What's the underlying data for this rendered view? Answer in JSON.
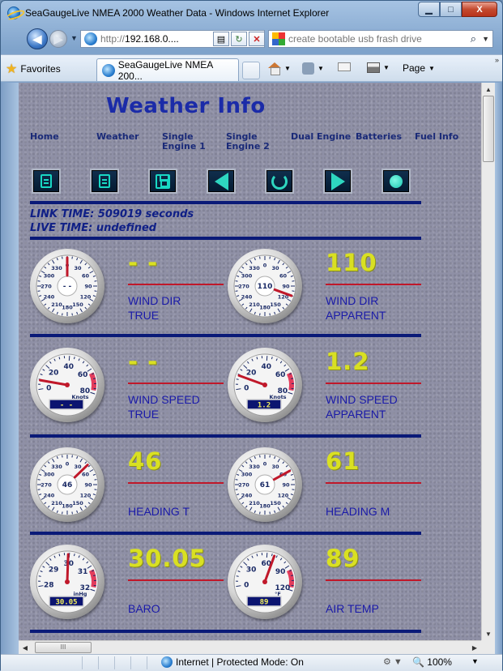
{
  "window": {
    "title": "SeaGaugeLive NMEA 2000 Weather Data - Windows Internet Explorer",
    "minimize": "▁",
    "maximize": "□",
    "close": "X"
  },
  "address": {
    "url_proto": "http://",
    "url_host": "192.168.0....",
    "search_placeholder": "create bootable usb frash drive"
  },
  "favorites": {
    "label": "Favorites",
    "tab_title": "SeaGaugeLive NMEA 200...",
    "page_menu": "Page"
  },
  "status": {
    "zone": "Internet | Protected Mode: On",
    "zoom": "100%"
  },
  "page": {
    "title": "Weather Info",
    "nav": [
      {
        "label": "Home"
      },
      {
        "label": "Weather"
      },
      {
        "label": "Single\nEngine 1"
      },
      {
        "label": "Single\nEngine 2"
      },
      {
        "label": "Dual Engine"
      },
      {
        "label": "Batteries"
      },
      {
        "label": "Fuel Info"
      }
    ],
    "toolbar": [
      "document-icon",
      "document-icon",
      "save-icon",
      "back-arrow-icon",
      "refresh-icon",
      "play-icon",
      "record-icon"
    ],
    "link_time": "LINK TIME: 509019 seconds",
    "live_time": "LIVE TIME: undefined",
    "gauges": [
      {
        "id": "wind-dir-true",
        "value": "- -",
        "label_1": "WIND DIR",
        "label_2": "TRUE",
        "center": "- -",
        "kind": "compass",
        "needle_deg": 0
      },
      {
        "id": "wind-dir-apparent",
        "value": "110",
        "label_1": "WIND DIR",
        "label_2": "APPARENT",
        "center": "110",
        "kind": "compass",
        "needle_deg": 110
      },
      {
        "id": "wind-speed-true",
        "value": "- -",
        "label_1": "WIND SPEED",
        "label_2": "TRUE",
        "center": "- -",
        "kind": "speed",
        "unit": "Knots",
        "needle_deg": -80
      },
      {
        "id": "wind-speed-apparent",
        "value": "1.2",
        "label_1": "WIND SPEED",
        "label_2": "APPARENT",
        "center": "1.2",
        "kind": "speed",
        "unit": "Knots",
        "needle_deg": -70
      },
      {
        "id": "heading-t",
        "value": "46",
        "label_1": "HEADING T",
        "label_2": "",
        "center": "46",
        "kind": "compass",
        "needle_deg": 46
      },
      {
        "id": "heading-m",
        "value": "61",
        "label_1": "HEADING M",
        "label_2": "",
        "center": "61",
        "kind": "compass",
        "needle_deg": 61
      },
      {
        "id": "baro",
        "value": "30.05",
        "label_1": "BARO",
        "label_2": "",
        "center": "30.05",
        "kind": "baro",
        "unit": "inHg",
        "needle_deg": 2
      },
      {
        "id": "air-temp",
        "value": "89",
        "label_1": "AIR TEMP",
        "label_2": "",
        "center": "89",
        "kind": "temp",
        "unit": "°F",
        "needle_deg": 20
      }
    ]
  },
  "colors": {
    "page_title": "#1b2ba8",
    "gauge_value": "#d9e022",
    "divider": "#0a1a78",
    "label": "#1a1aa8",
    "red_line": "#c0182a"
  }
}
